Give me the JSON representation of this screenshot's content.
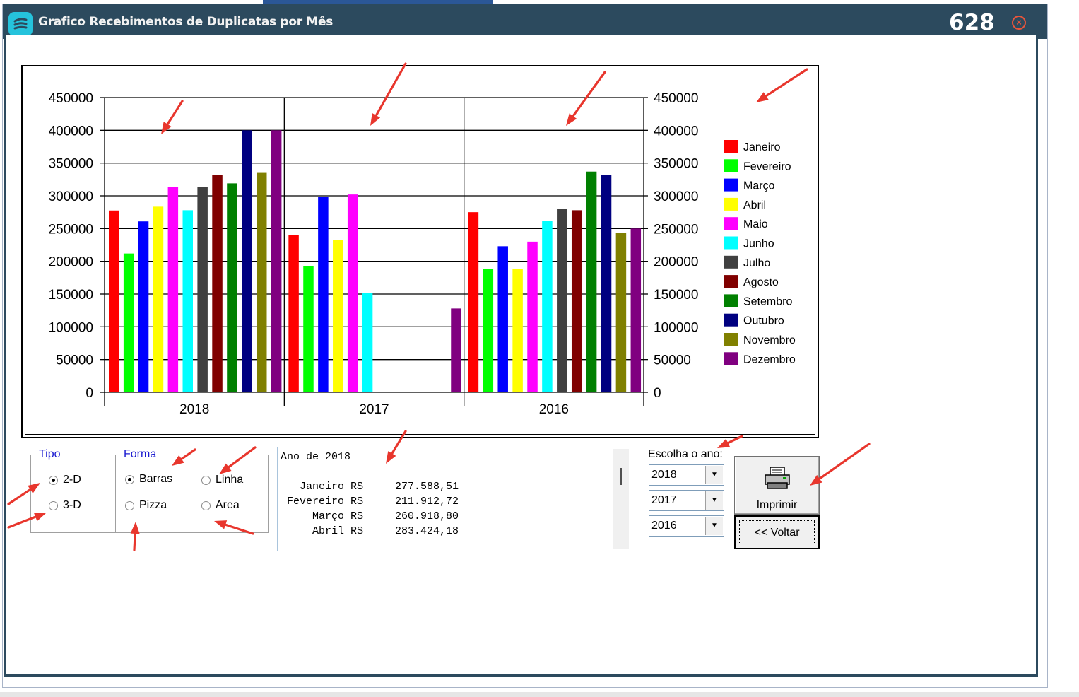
{
  "window": {
    "title": "Grafico Recebimentos de Duplicatas por Mês",
    "number": "628",
    "close_icon": "close-circle-icon",
    "app_icon": "app-logo-icon"
  },
  "chart_data": {
    "type": "bar",
    "categories": [
      "2018",
      "2017",
      "2016"
    ],
    "ylim": [
      0,
      450000
    ],
    "yticks": [
      "0",
      "50000",
      "100000",
      "150000",
      "200000",
      "250000",
      "300000",
      "350000",
      "400000",
      "450000"
    ],
    "grid": true,
    "legend": "right",
    "series": [
      {
        "name": "Janeiro",
        "color": "#ff0000",
        "values": [
          277588.51,
          240000,
          275000
        ]
      },
      {
        "name": "Fevereiro",
        "color": "#00ff00",
        "values": [
          211912.72,
          193000,
          188000
        ]
      },
      {
        "name": "Março",
        "color": "#0000ff",
        "values": [
          260918.8,
          298000,
          223000
        ]
      },
      {
        "name": "Abril",
        "color": "#ffff00",
        "values": [
          283424.18,
          233000,
          188000
        ]
      },
      {
        "name": "Maio",
        "color": "#ff00ff",
        "values": [
          314000,
          302000,
          230000
        ]
      },
      {
        "name": "Junho",
        "color": "#00ffff",
        "values": [
          278000,
          152000,
          262000
        ]
      },
      {
        "name": "Julho",
        "color": "#404040",
        "values": [
          314000,
          0,
          280000
        ]
      },
      {
        "name": "Agosto",
        "color": "#800000",
        "values": [
          332000,
          0,
          278000
        ]
      },
      {
        "name": "Setembro",
        "color": "#008000",
        "values": [
          319000,
          0,
          337000
        ]
      },
      {
        "name": "Outubro",
        "color": "#000080",
        "values": [
          400000,
          0,
          332000
        ]
      },
      {
        "name": "Novembro",
        "color": "#808000",
        "values": [
          335000,
          0,
          243000
        ]
      },
      {
        "name": "Dezembro",
        "color": "#800080",
        "values": [
          400000,
          128000,
          250000
        ]
      }
    ]
  },
  "tipo": {
    "label": "Tipo",
    "options": [
      {
        "label": "2-D",
        "checked": true
      },
      {
        "label": "3-D",
        "checked": false
      }
    ]
  },
  "forma": {
    "label": "Forma",
    "options": [
      {
        "label": "Barras",
        "checked": true
      },
      {
        "label": "Linha",
        "checked": false
      },
      {
        "label": "Pizza",
        "checked": false
      },
      {
        "label": "Area",
        "checked": false
      }
    ]
  },
  "summary_text": "Ano de 2018\n\n   Janeiro R$     277.588,51\n Fevereiro R$     211.912,72\n     Março R$     260.918,80\n     Abril R$     283.424,18",
  "year_select": {
    "label": "Escolha o ano:",
    "values": [
      "2018",
      "2017",
      "2016"
    ]
  },
  "buttons": {
    "print_label": "Imprimir",
    "print_icon": "printer-icon",
    "back_label": "<< Voltar"
  },
  "annotation": {
    "color": "#e8362d",
    "arrow_icon": "red-arrow-icon"
  }
}
